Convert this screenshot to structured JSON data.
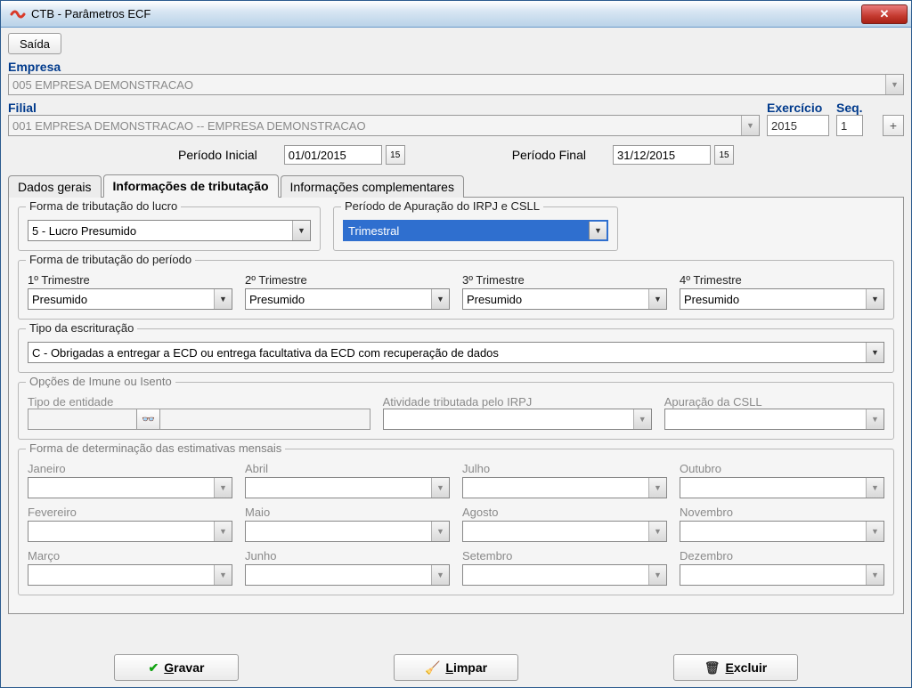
{
  "titlebar": {
    "title": "CTB - Parâmetros ECF",
    "close": "x"
  },
  "toolbar": {
    "saida": "Saída"
  },
  "header": {
    "empresa_label": "Empresa",
    "empresa_value": "005 EMPRESA DEMONSTRACAO",
    "filial_label": "Filial",
    "filial_value": "001 EMPRESA DEMONSTRACAO -- EMPRESA DEMONSTRACAO",
    "exercicio_label": "Exercício",
    "exercicio_value": "2015",
    "seq_label": "Seq.",
    "seq_value": "1"
  },
  "periodo": {
    "inicial_label": "Período Inicial",
    "inicial_value": "01/01/2015",
    "final_label": "Período Final",
    "final_value": "31/12/2015",
    "cal_icon": "15"
  },
  "tabs": {
    "t1": "Dados gerais",
    "t2": "Informações de tributação",
    "t3": "Informações complementares"
  },
  "grp_forma_lucro": {
    "legend": "Forma de tributação do lucro",
    "value": "5 - Lucro Presumido"
  },
  "grp_periodo_apuracao": {
    "legend": "Período de Apuração do IRPJ e CSLL",
    "value": "Trimestral"
  },
  "grp_forma_periodo": {
    "legend": "Forma de tributação do período",
    "q1_label": "1º Trimestre",
    "q1": "Presumido",
    "q2_label": "2º Trimestre",
    "q2": "Presumido",
    "q3_label": "3º Trimestre",
    "q3": "Presumido",
    "q4_label": "4º Trimestre",
    "q4": "Presumido"
  },
  "grp_tipo_escr": {
    "legend": "Tipo da escrituração",
    "value": "C - Obrigadas a entregar a ECD ou entrega facultativa da ECD com recuperação de dados"
  },
  "grp_opcoes": {
    "legend": "Opções de Imune ou Isento",
    "tipo_entidade_label": "Tipo de entidade",
    "atividade_label": "Atividade tributada pelo IRPJ",
    "apuracao_label": "Apuração da CSLL"
  },
  "grp_estimativas": {
    "legend": "Forma de determinação das estimativas mensais",
    "m1": "Janeiro",
    "m2": "Fevereiro",
    "m3": "Março",
    "m4": "Abril",
    "m5": "Maio",
    "m6": "Junho",
    "m7": "Julho",
    "m8": "Agosto",
    "m9": "Setembro",
    "m10": "Outubro",
    "m11": "Novembro",
    "m12": "Dezembro"
  },
  "footer": {
    "gravar": "Gravar",
    "limpar": "Limpar",
    "excluir": "Excluir"
  },
  "icons": {
    "binoc": "🔍",
    "check": "✔",
    "broom": "🧹",
    "trash": "🗑",
    "plus": "+",
    "close": "✕"
  }
}
